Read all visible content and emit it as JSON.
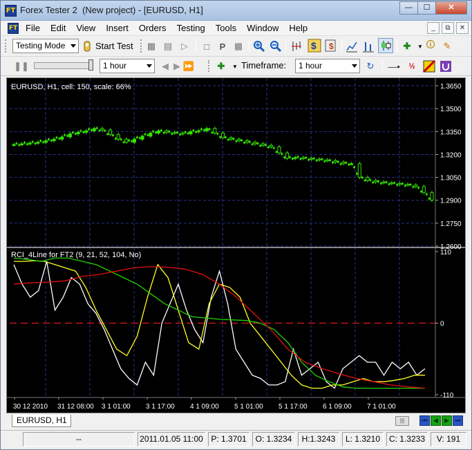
{
  "window": {
    "title": "Forex Tester 2  (New project) - [EURUSD, H1]",
    "app_icon_label": "FT"
  },
  "menu": [
    "File",
    "Edit",
    "View",
    "Insert",
    "Orders",
    "Testing",
    "Tools",
    "Window",
    "Help"
  ],
  "toolbar": {
    "mode_select": "Testing Mode",
    "start_test": "Start Test",
    "speed_select": "1 hour",
    "timeframe_label": "Timeframe:",
    "timeframe_select": "1 hour"
  },
  "chart": {
    "price_header": "EURUSD, H1, cell: 150, scale: 66%",
    "indicator_header": "RCI_4Line for FT2 (9, 21, 52, 104, No)",
    "price_ticks": [
      "1.3650",
      "1.3500",
      "1.3350",
      "1.3200",
      "1.3050",
      "1.2900",
      "1.2750",
      "1.2600"
    ],
    "indicator_ticks": [
      "110",
      "0",
      "-110"
    ],
    "time_ticks": [
      "30 12 2010",
      "31 12 08:00",
      "3 1 01:00",
      "3 1 17:00",
      "4 1 09:00",
      "5 1 01:00",
      "5 1 17:00",
      "6 1 09:00",
      "7 1 01:00"
    ],
    "colors": {
      "background": "#000000",
      "grid": "#27358f",
      "candle": "#34e600",
      "rci_9": "#ffffff",
      "rci_21": "#ffff22",
      "rci_52": "#22d400",
      "rci_104": "#e21010",
      "zero_line": "#c8141e"
    }
  },
  "chart_data": [
    {
      "type": "line",
      "title": "EURUSD, H1, cell: 150, scale: 66%",
      "ylim": [
        1.26,
        1.37
      ],
      "x_ticks": [
        "30 12 2010",
        "31 12 08:00",
        "3 1 01:00",
        "3 1 17:00",
        "4 1 09:00",
        "5 1 01:00",
        "5 1 17:00",
        "6 1 09:00",
        "7 1 01:00"
      ],
      "series": [
        {
          "name": "EURUSD",
          "values": [
            1.3265,
            1.327,
            1.3275,
            1.328,
            1.329,
            1.33,
            1.3315,
            1.3335,
            1.3345,
            1.3355,
            1.337,
            1.336,
            1.333,
            1.33,
            1.328,
            1.33,
            1.332,
            1.334,
            1.3355,
            1.3345,
            1.334,
            1.3335,
            1.335,
            1.3355,
            1.337,
            1.334,
            1.331,
            1.33,
            1.329,
            1.328,
            1.327,
            1.326,
            1.325,
            1.321,
            1.3175,
            1.318,
            1.3175,
            1.317,
            1.3165,
            1.316,
            1.315,
            1.314,
            1.314,
            1.305,
            1.303,
            1.302,
            1.3015,
            1.301,
            1.3005,
            1.3,
            1.299,
            1.295,
            1.29
          ]
        }
      ]
    },
    {
      "type": "line",
      "title": "RCI_4Line for FT2 (9, 21, 52, 104, No)",
      "ylim": [
        -110,
        110
      ],
      "series": [
        {
          "values": [
            90,
            60,
            40,
            50,
            95,
            20,
            40,
            70,
            60,
            30,
            15,
            -10,
            -40,
            -70,
            -85,
            -95,
            -60,
            -80,
            0,
            30,
            60,
            20,
            -10,
            -30,
            40,
            80,
            30,
            -40,
            -60,
            -80,
            -85,
            -95,
            -95,
            -90,
            -40,
            -80,
            -70,
            -60,
            -90,
            -100,
            -70,
            -60,
            -50,
            -60,
            -60,
            -80,
            -60,
            -70,
            -60,
            -80,
            -70
          ]
        },
        {
          "values": [
            95,
            95,
            96,
            95,
            90,
            85,
            80,
            55,
            20,
            -10,
            -40,
            -50,
            -20,
            40,
            90,
            70,
            20,
            -30,
            -40,
            30,
            60,
            55,
            40,
            0,
            -20,
            -40,
            -60,
            -80,
            -95,
            -100,
            -100,
            -95,
            -95,
            -90,
            -85,
            -90,
            -90,
            -88,
            -85,
            -80,
            -80
          ]
        },
        {
          "values": [
            100,
            98,
            95,
            100,
            100,
            95,
            90,
            80,
            70,
            60,
            45,
            30,
            20,
            10,
            8,
            6,
            5,
            4,
            0,
            -10,
            -30,
            -60,
            -80,
            -90,
            -98,
            -100,
            -100,
            -100,
            -100,
            -100,
            -100
          ]
        },
        {
          "values": [
            60,
            62,
            63,
            65,
            72,
            75,
            80,
            85,
            87,
            86,
            83,
            75,
            60,
            40,
            15,
            -10,
            -40,
            -60,
            -70,
            -78,
            -85,
            -90,
            -95,
            -98,
            -100
          ]
        }
      ]
    }
  ],
  "tabs": [
    "EURUSD, H1"
  ],
  "status": [
    "--",
    "2011.01.05 11:00",
    "P: 1.3701",
    "O: 1.3234",
    "H:1.3243",
    "L: 1.3210",
    "C: 1.3233",
    "V: 191"
  ]
}
